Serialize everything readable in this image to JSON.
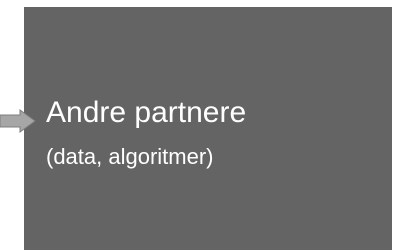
{
  "node": {
    "title": "Andre partnere",
    "subtitle": "(data, algoritmer)"
  },
  "colors": {
    "box_fill": "#646464",
    "text": "#ffffff",
    "arrow": "#a6a6a6",
    "arrow_outline": "#7f7f7f",
    "background": "#ffffff"
  }
}
